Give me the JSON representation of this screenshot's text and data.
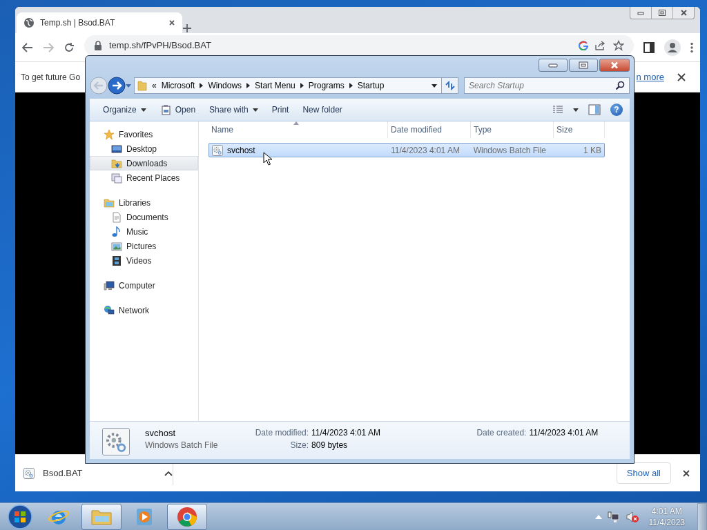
{
  "browser": {
    "tab": {
      "title": "Temp.sh | Bsod.BAT"
    },
    "address": "temp.sh/fPvPH/Bsod.BAT",
    "infobar": {
      "message": "To get future Go",
      "link": "n more"
    },
    "download": {
      "file": "Bsod.BAT",
      "show_all": "Show all"
    }
  },
  "explorer": {
    "breadcrumb": {
      "overflow": "«",
      "items": [
        "Microsoft",
        "Windows",
        "Start Menu",
        "Programs",
        "Startup"
      ]
    },
    "search": {
      "placeholder": "Search Startup"
    },
    "commands": [
      {
        "label": "Organize",
        "kind": "menu"
      },
      {
        "label": "Open",
        "kind": "open"
      },
      {
        "label": "Share with",
        "kind": "menu"
      },
      {
        "label": "Print",
        "kind": "plain"
      },
      {
        "label": "New folder",
        "kind": "plain"
      }
    ],
    "help": "?",
    "nav": [
      {
        "label": "Favorites",
        "kind": "favorites",
        "selected": false,
        "children": [
          {
            "label": "Desktop",
            "kind": "desktop",
            "selected": false
          },
          {
            "label": "Downloads",
            "kind": "downloads",
            "selected": true
          },
          {
            "label": "Recent Places",
            "kind": "recent",
            "selected": false
          }
        ]
      },
      {
        "label": "Libraries",
        "kind": "libraries",
        "selected": false,
        "children": [
          {
            "label": "Documents",
            "kind": "documents",
            "selected": false
          },
          {
            "label": "Music",
            "kind": "music",
            "selected": false
          },
          {
            "label": "Pictures",
            "kind": "pictures",
            "selected": false
          },
          {
            "label": "Videos",
            "kind": "videos",
            "selected": false
          }
        ]
      },
      {
        "label": "Computer",
        "kind": "computer",
        "selected": false
      },
      {
        "label": "Network",
        "kind": "network",
        "selected": false
      }
    ],
    "columns": [
      "Name",
      "Date modified",
      "Type",
      "Size"
    ],
    "files": [
      {
        "name": "svchost",
        "date": "11/4/2023 4:01 AM",
        "type": "Windows Batch File",
        "size": "1 KB",
        "selected": true
      }
    ],
    "details": {
      "name": "svchost",
      "type": "Windows Batch File",
      "fields": [
        {
          "label": "Date modified:",
          "value": "11/4/2023 4:01 AM"
        },
        {
          "label": "Size:",
          "value": "809 bytes"
        },
        {
          "label": "Date created:",
          "value": "11/4/2023 4:01 AM"
        }
      ]
    }
  },
  "taskbar": {
    "items": [
      {
        "kind": "start"
      },
      {
        "kind": "ie",
        "active": false
      },
      {
        "kind": "explorer",
        "active": true
      },
      {
        "kind": "media",
        "active": false
      },
      {
        "kind": "chrome",
        "active": true
      }
    ],
    "clock": {
      "time": "4:01 AM",
      "date": "11/4/2023"
    }
  }
}
